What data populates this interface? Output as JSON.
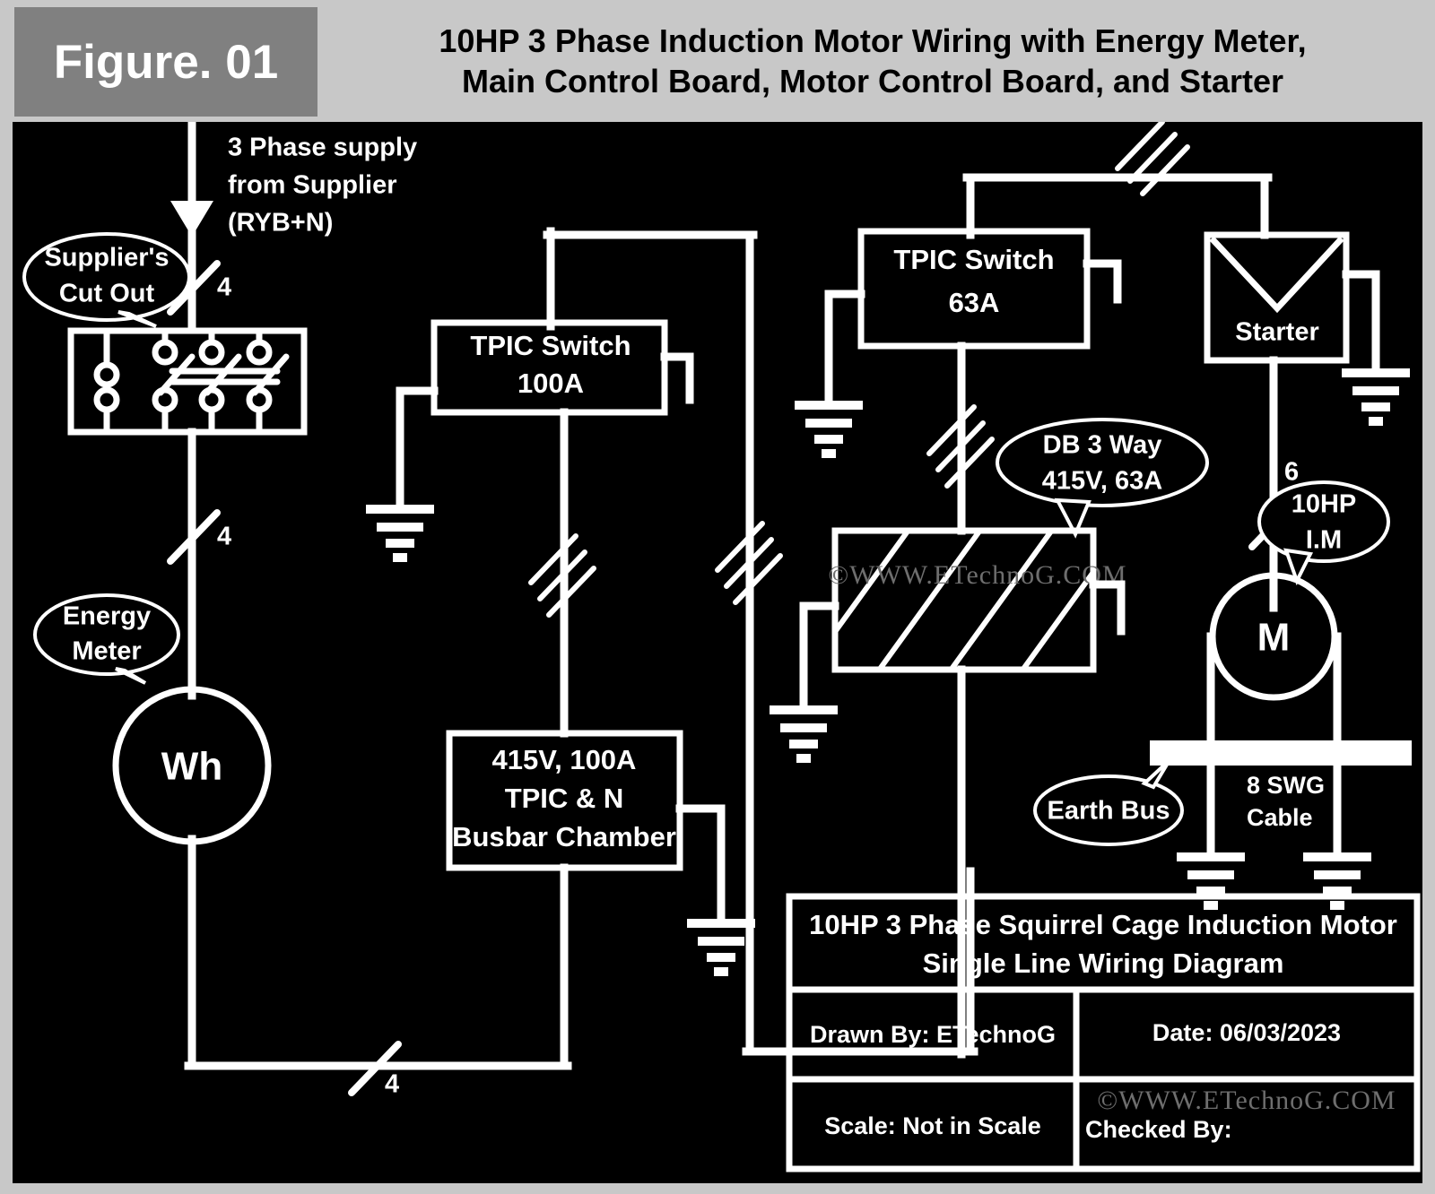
{
  "header": {
    "figure_label": "Figure. 01",
    "title_line1": "10HP 3 Phase Induction Motor Wiring with Energy Meter,",
    "title_line2": "Main Control Board, Motor Control Board, and Starter"
  },
  "colors": {
    "background": "#000000",
    "wire": "#ffffff",
    "page_border": "#c8c8c8",
    "badge": "#808080",
    "watermark": "#6e6e6e"
  },
  "annotations": {
    "supply_note_l1": "3 Phase supply",
    "supply_note_l2": "from Supplier",
    "supply_note_l3": "(RYB+N)",
    "suppliers_cutout_l1": "Supplier's",
    "suppliers_cutout_l2": "Cut Out",
    "energy_meter_l1": "Energy",
    "energy_meter_l2": "Meter",
    "db_3way_l1": "DB 3 Way",
    "db_3way_l2": "415V, 63A",
    "im_l1": "10HP",
    "im_l2": "I.M",
    "earth_bus": "Earth Bus",
    "swg_l1": "8 SWG",
    "swg_l2": "Cable"
  },
  "components": {
    "energy_meter_symbol": "Wh",
    "motor_symbol": "M",
    "starter_label": "Starter",
    "tpic_100_l1": "TPIC Switch",
    "tpic_100_l2": "100A",
    "tpic_63_l1": "TPIC Switch",
    "tpic_63_l2": "63A",
    "busbar_l1": "415V, 100A",
    "busbar_l2": "TPIC & N",
    "busbar_l3": "Busbar Chamber"
  },
  "cable_marks": {
    "cutout_in": "4",
    "cutout_out": "4",
    "meter_out": "4",
    "motor_feed": "6"
  },
  "title_block": {
    "title_l1": "10HP 3 Phase Squirrel Cage Induction Motor",
    "title_l2": "Single Line Wiring Diagram",
    "drawn_by": "Drawn By: ETechnoG",
    "date": "Date: 06/03/2023",
    "scale": "Scale: Not in Scale",
    "checked_by": "Checked By:"
  },
  "watermark": {
    "center": "©WWW.ETechnoG.COM",
    "bottom": "©WWW.ETechnoG.COM"
  }
}
